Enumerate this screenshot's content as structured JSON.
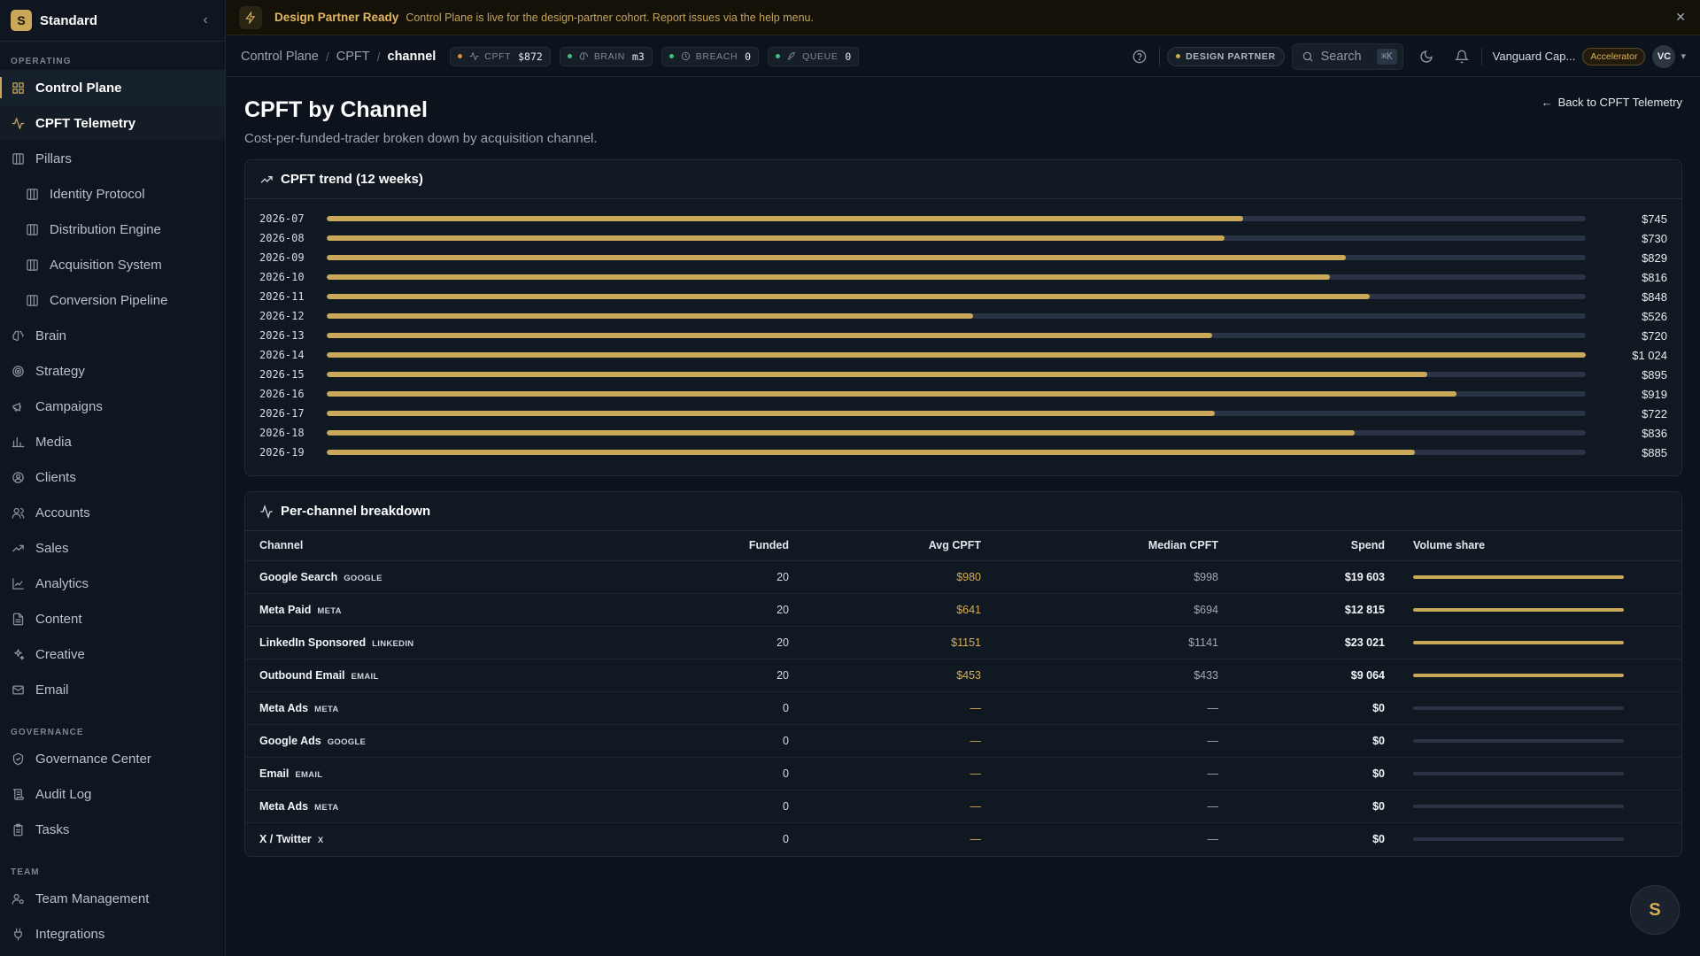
{
  "workspace": {
    "initial": "S",
    "name": "Standard"
  },
  "sidebar": {
    "sections": [
      {
        "title": "OPERATING",
        "items": [
          {
            "label": "Control Plane",
            "icon": "grid-icon",
            "state": "active"
          },
          {
            "label": "CPFT Telemetry",
            "icon": "activity-icon",
            "state": "highlight"
          },
          {
            "label": "Pillars",
            "icon": "columns-icon"
          },
          {
            "label": "Identity Protocol",
            "icon": "columns-icon",
            "sub": true
          },
          {
            "label": "Distribution Engine",
            "icon": "columns-icon",
            "sub": true
          },
          {
            "label": "Acquisition System",
            "icon": "columns-icon",
            "sub": true
          },
          {
            "label": "Conversion Pipeline",
            "icon": "columns-icon",
            "sub": true
          },
          {
            "label": "Brain",
            "icon": "brain-icon"
          },
          {
            "label": "Strategy",
            "icon": "target-icon"
          },
          {
            "label": "Campaigns",
            "icon": "megaphone-icon"
          },
          {
            "label": "Media",
            "icon": "bar-chart-icon"
          },
          {
            "label": "Clients",
            "icon": "user-circle-icon"
          },
          {
            "label": "Accounts",
            "icon": "users-icon"
          },
          {
            "label": "Sales",
            "icon": "trending-up-icon"
          },
          {
            "label": "Analytics",
            "icon": "line-chart-icon"
          },
          {
            "label": "Content",
            "icon": "file-text-icon"
          },
          {
            "label": "Creative",
            "icon": "sparkles-icon"
          },
          {
            "label": "Email",
            "icon": "mail-icon"
          }
        ]
      },
      {
        "title": "GOVERNANCE",
        "items": [
          {
            "label": "Governance Center",
            "icon": "shield-check-icon"
          },
          {
            "label": "Audit Log",
            "icon": "scroll-icon"
          },
          {
            "label": "Tasks",
            "icon": "clipboard-icon"
          }
        ]
      },
      {
        "title": "TEAM",
        "items": [
          {
            "label": "Team Management",
            "icon": "user-cog-icon"
          },
          {
            "label": "Integrations",
            "icon": "plug-icon"
          }
        ]
      }
    ]
  },
  "banner": {
    "title": "Design Partner Ready",
    "text": "Control Plane is live for the design-partner cohort. Report issues via the help menu."
  },
  "breadcrumb": [
    "Control Plane",
    "CPFT",
    "channel"
  ],
  "status_pills": [
    {
      "label": "CPFT",
      "value": "$872",
      "dot": "#e0893a",
      "icon": "activity-icon"
    },
    {
      "label": "BRAIN",
      "value": "m3",
      "dot": "#3fbf7f",
      "icon": "brain-icon"
    },
    {
      "label": "BREACH",
      "value": "0",
      "dot": "#3fbf7f",
      "icon": "clock-icon"
    },
    {
      "label": "QUEUE",
      "value": "0",
      "dot": "#3fbf7f",
      "icon": "rocket-icon"
    }
  ],
  "topbar": {
    "partner_badge": "DESIGN PARTNER",
    "search_placeholder": "Search",
    "search_shortcut": "⌘K",
    "org_name": "Vanguard Cap...",
    "tier": "Accelerator",
    "avatar": "VC"
  },
  "page": {
    "title": "CPFT by Channel",
    "subtitle": "Cost-per-funded-trader broken down by acquisition channel.",
    "back_label": "Back to CPFT Telemetry"
  },
  "trend": {
    "title": "CPFT trend (12 weeks)",
    "max": 1024,
    "rows": [
      {
        "week": "2026-07",
        "value": 745,
        "label": "$745"
      },
      {
        "week": "2026-08",
        "value": 730,
        "label": "$730"
      },
      {
        "week": "2026-09",
        "value": 829,
        "label": "$829"
      },
      {
        "week": "2026-10",
        "value": 816,
        "label": "$816"
      },
      {
        "week": "2026-11",
        "value": 848,
        "label": "$848"
      },
      {
        "week": "2026-12",
        "value": 526,
        "label": "$526"
      },
      {
        "week": "2026-13",
        "value": 720,
        "label": "$720"
      },
      {
        "week": "2026-14",
        "value": 1024,
        "label": "$1 024"
      },
      {
        "week": "2026-15",
        "value": 895,
        "label": "$895"
      },
      {
        "week": "2026-16",
        "value": 919,
        "label": "$919"
      },
      {
        "week": "2026-17",
        "value": 722,
        "label": "$722"
      },
      {
        "week": "2026-18",
        "value": 836,
        "label": "$836"
      },
      {
        "week": "2026-19",
        "value": 885,
        "label": "$885"
      }
    ]
  },
  "breakdown": {
    "title": "Per-channel breakdown",
    "columns": [
      "Channel",
      "Funded",
      "Avg CPFT",
      "Median CPFT",
      "Spend",
      "Volume share"
    ],
    "rows": [
      {
        "name": "Google Search",
        "tag": "GOOGLE",
        "funded": "20",
        "avg": "$980",
        "median": "$998",
        "spend": "$19 603",
        "share": 1.0
      },
      {
        "name": "Meta Paid",
        "tag": "META",
        "funded": "20",
        "avg": "$641",
        "median": "$694",
        "spend": "$12 815",
        "share": 1.0
      },
      {
        "name": "LinkedIn Sponsored",
        "tag": "LINKEDIN",
        "funded": "20",
        "avg": "$1151",
        "median": "$1141",
        "spend": "$23 021",
        "share": 1.0
      },
      {
        "name": "Outbound Email",
        "tag": "EMAIL",
        "funded": "20",
        "avg": "$453",
        "median": "$433",
        "spend": "$9 064",
        "share": 1.0
      },
      {
        "name": "Meta Ads",
        "tag": "META",
        "funded": "0",
        "avg": "—",
        "median": "—",
        "spend": "$0",
        "share": 0
      },
      {
        "name": "Google Ads",
        "tag": "GOOGLE",
        "funded": "0",
        "avg": "—",
        "median": "—",
        "spend": "$0",
        "share": 0
      },
      {
        "name": "Email",
        "tag": "EMAIL",
        "funded": "0",
        "avg": "—",
        "median": "—",
        "spend": "$0",
        "share": 0
      },
      {
        "name": "Meta Ads",
        "tag": "META",
        "funded": "0",
        "avg": "—",
        "median": "—",
        "spend": "$0",
        "share": 0
      },
      {
        "name": "X / Twitter",
        "tag": "X",
        "funded": "0",
        "avg": "—",
        "median": "—",
        "spend": "$0",
        "share": 0
      }
    ]
  },
  "fab_label": "S",
  "colors": {
    "accent": "#c9a85a",
    "background": "#0d131c",
    "track": "#2a3444"
  }
}
